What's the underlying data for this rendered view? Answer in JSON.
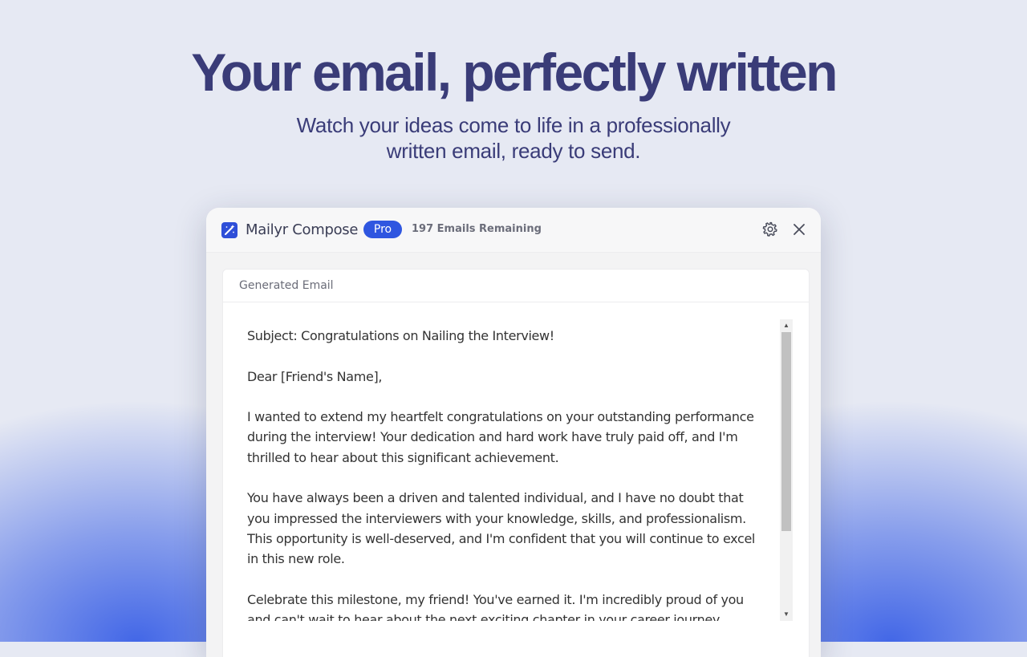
{
  "hero": {
    "title": "Your email, perfectly written",
    "subtitle": "Watch your ideas come to life in a professionally written email, ready to send."
  },
  "app": {
    "name": "Mailyr Compose",
    "badge": "Pro",
    "remaining": "197 Emails Remaining",
    "icons": {
      "logo": "magic-wand-icon",
      "settings": "gear-icon",
      "close": "close-icon"
    }
  },
  "generated": {
    "label": "Generated Email",
    "paragraphs": [
      "Subject: Congratulations on Nailing the Interview!",
      "Dear [Friend's Name],",
      "I wanted to extend my heartfelt congratulations on your outstanding performance during the interview! Your dedication and hard work have truly paid off, and I'm thrilled to hear about this significant achievement.",
      "You have always been a driven and talented individual, and I have no doubt that you impressed the interviewers with your knowledge, skills, and professionalism. This opportunity is well-deserved, and I'm confident that you will continue to excel in this new role.",
      "Celebrate this milestone, my friend! You've earned it. I'm incredibly proud of you and can't wait to hear about the next exciting chapter in your career journey."
    ]
  },
  "colors": {
    "background": "#e6e9f3",
    "heading": "#3a3c78",
    "accent": "#2f56e0",
    "glow": "#3a60e6"
  }
}
